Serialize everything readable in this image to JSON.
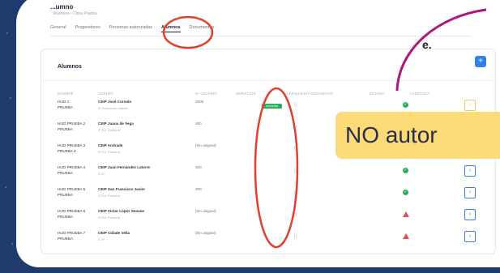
{
  "app": {
    "title": "...umno",
    "breadcrumb": "...Alumnos • Clara Prueba"
  },
  "tabs": [
    {
      "label": "General",
      "active": false
    },
    {
      "label": "Progenitores",
      "active": false
    },
    {
      "label": "Personas autorizadas",
      "active": false
    },
    {
      "label": "Alumnos",
      "active": true
    },
    {
      "label": "Documentos",
      "active": false
    }
  ],
  "card": {
    "title": "Alumnos",
    "add_icon": "+"
  },
  "table": {
    "headers": [
      "NOMBRE",
      "CENTRO",
      "Nº USUARIO",
      "SERVICIOS",
      "ALERGIAS/INTOLERANCIAS",
      "ESTADO",
      "LUDOTECA"
    ],
    "rows": [
      {
        "name1": "HIJO 1",
        "name2": "PRUEBA",
        "centro": "CEIP José Cornide",
        "curso": "4º Educación Infantil",
        "usuario": "0000",
        "servicio": "Comedor",
        "estado": "ok",
        "go": "dim"
      },
      {
        "name1": "HIJO PRUEBA 2",
        "name2": "PRUEBA",
        "centro": "CEIP Juana de Vega",
        "curso": "3º Ed. Primaria",
        "usuario": "000",
        "servicio": "",
        "estado": "ok",
        "go": "dim"
      },
      {
        "name1": "HIJO PRUEBA 3",
        "name2": "PRUEBA 3",
        "centro": "CEIP Andrade",
        "curso": "5º Ed. Primaria",
        "usuario": "[Sin asignar]",
        "servicio": "",
        "estado": "warn",
        "go": "dim"
      },
      {
        "name1": "HIJO PRUEBA 4",
        "name2": "PRUEBA",
        "centro": "CEIP Juan Fernández Latorre",
        "curso": "O 4º",
        "usuario": "000",
        "servicio": "",
        "estado": "ok",
        "go": "normal"
      },
      {
        "name1": "HIJO PRUEBA 5",
        "name2": "PRUEBA",
        "centro": "CEIP San Francisco Javier",
        "curso": "3º Ed. Primaria",
        "usuario": "000",
        "servicio": "",
        "estado": "ok",
        "go": "normal"
      },
      {
        "name1": "HIJO PRUEBA 6",
        "name2": "PRUEBA",
        "centro": "CEIP Víctor López Seoane",
        "curso": "3º Ed. Primaria",
        "usuario": "[Sin asignar]",
        "servicio": "",
        "estado": "warn",
        "go": "normal"
      },
      {
        "name1": "HIJO PRUEBA 7",
        "name2": "PRUEBA",
        "centro": "CEIP Cidade Vella",
        "curso": "O 4º",
        "usuario": "[Sin asignar]",
        "servicio": "",
        "estado": "warn",
        "go": "normal"
      }
    ]
  },
  "overlay": {
    "e_label": "e.",
    "note": "NO autor"
  },
  "colors": {
    "background": "#1f3a6c",
    "accent": "#2f80ed",
    "ok": "#27ae60",
    "warn": "#e74c5c",
    "annotation_red": "#e0412d",
    "annotation_magenta": "#b0157a",
    "note_bg": "#fbdb78"
  }
}
